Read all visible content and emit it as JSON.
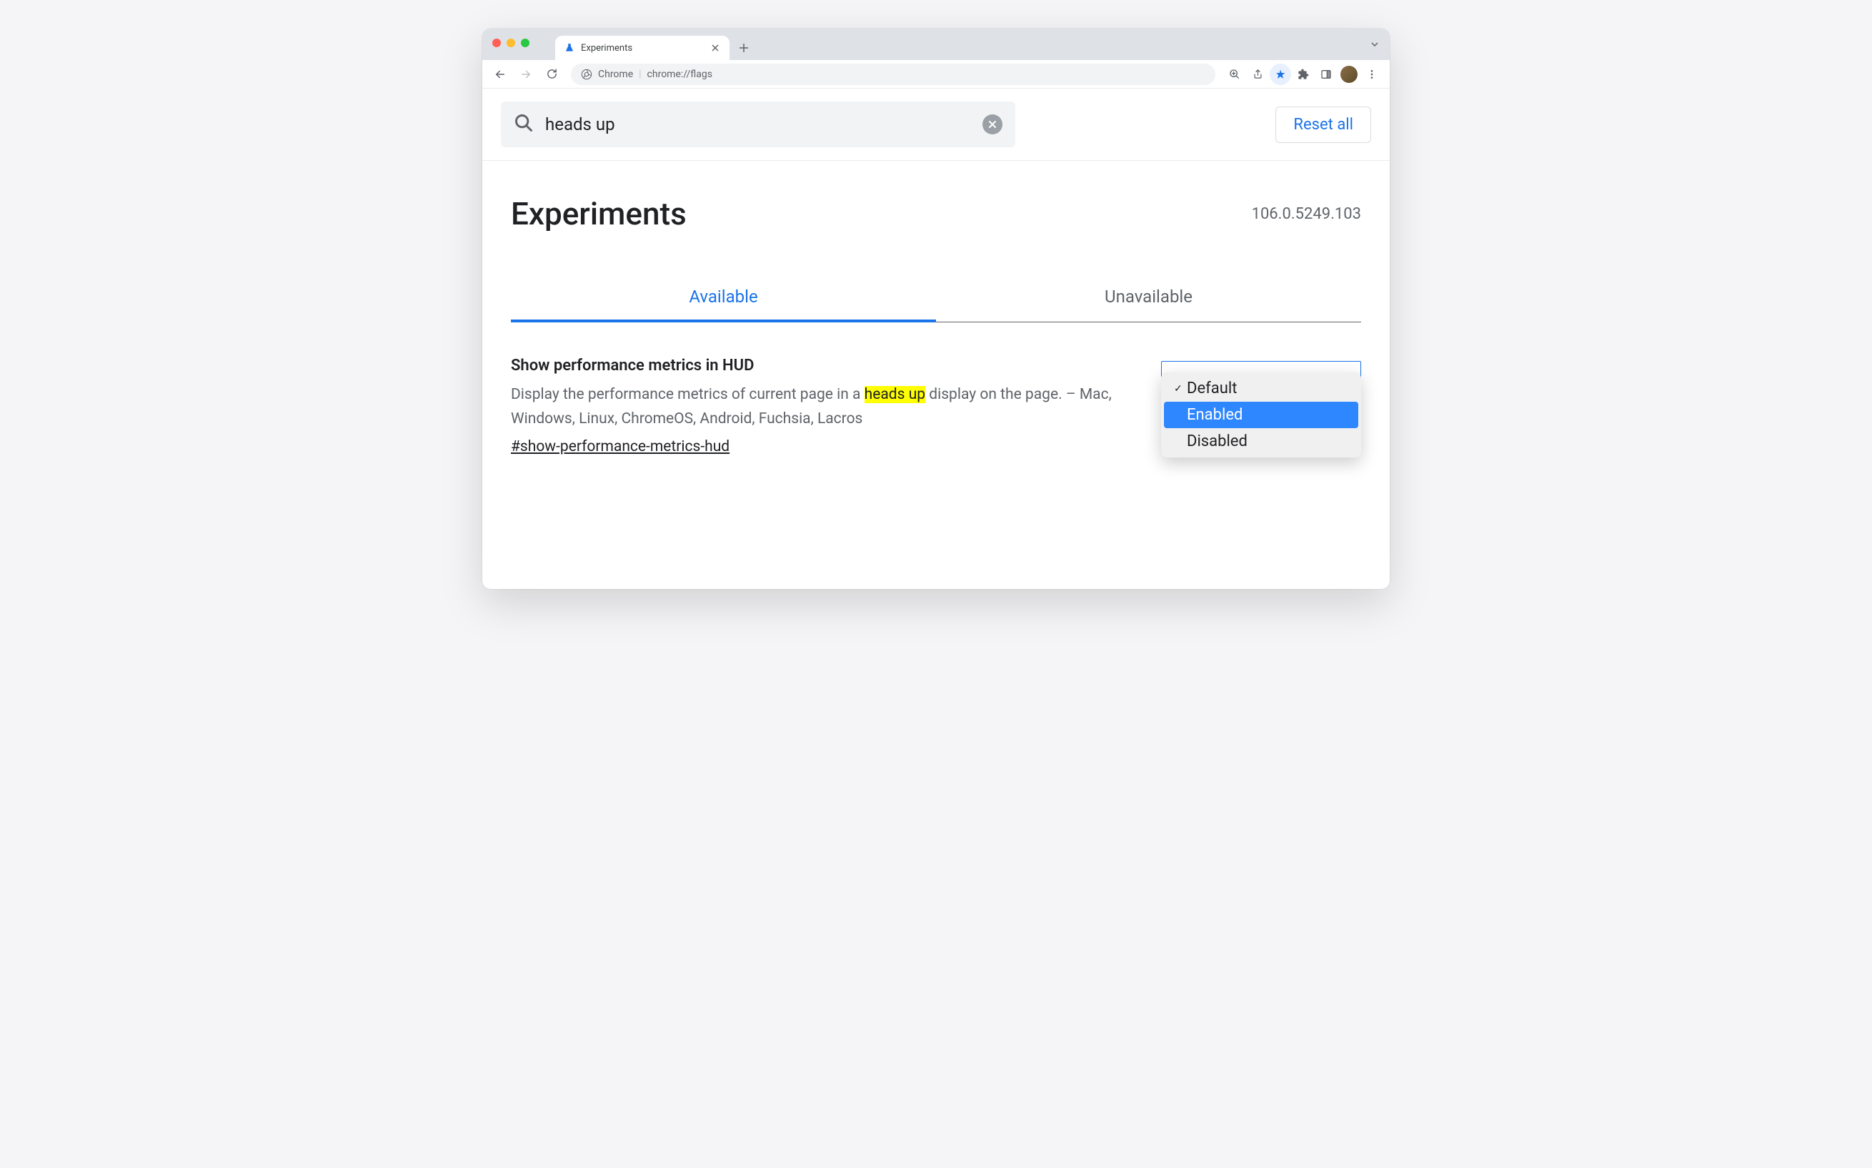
{
  "browser": {
    "tab": {
      "title": "Experiments"
    },
    "omnibox": {
      "prefix": "Chrome",
      "url": "chrome://flags"
    }
  },
  "page": {
    "search": {
      "value": "heads up"
    },
    "reset_button": "Reset all",
    "title": "Experiments",
    "version": "106.0.5249.103",
    "tabs": {
      "available": "Available",
      "unavailable": "Unavailable"
    },
    "flag": {
      "title": "Show performance metrics in HUD",
      "description_before": "Display the performance metrics of current page in a ",
      "description_highlight": "heads up",
      "description_after": " display on the page. – Mac, Windows, Linux, ChromeOS, Android, Fuchsia, Lacros",
      "anchor": "#show-performance-metrics-hud",
      "dropdown": {
        "options": [
          "Default",
          "Enabled",
          "Disabled"
        ],
        "current": "Default",
        "hovered": "Enabled"
      }
    }
  }
}
